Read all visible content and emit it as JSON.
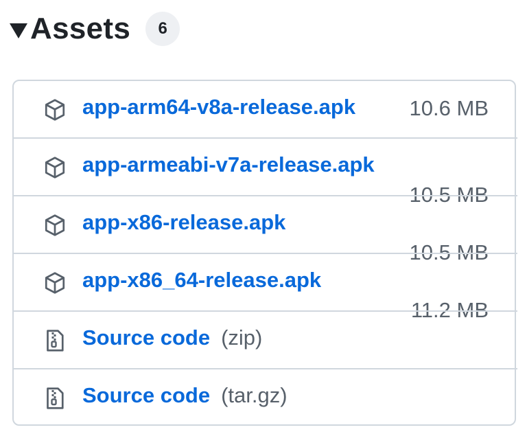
{
  "section": {
    "title": "Assets",
    "count": "6"
  },
  "assets": [
    {
      "name": "app-arm64-v8a-release.apk",
      "size": "10.6 MB",
      "icon": "package-icon"
    },
    {
      "name": "app-armeabi-v7a-release.apk",
      "size": "10.5 MB",
      "icon": "package-icon"
    },
    {
      "name": "app-x86-release.apk",
      "size": "10.5 MB",
      "icon": "package-icon"
    },
    {
      "name": "app-x86_64-release.apk",
      "size": "11.2 MB",
      "icon": "package-icon"
    }
  ],
  "sources": [
    {
      "label": "Source code",
      "format": "(zip)",
      "icon": "file-zip-icon"
    },
    {
      "label": "Source code",
      "format": "(tar.gz)",
      "icon": "file-zip-icon"
    }
  ]
}
